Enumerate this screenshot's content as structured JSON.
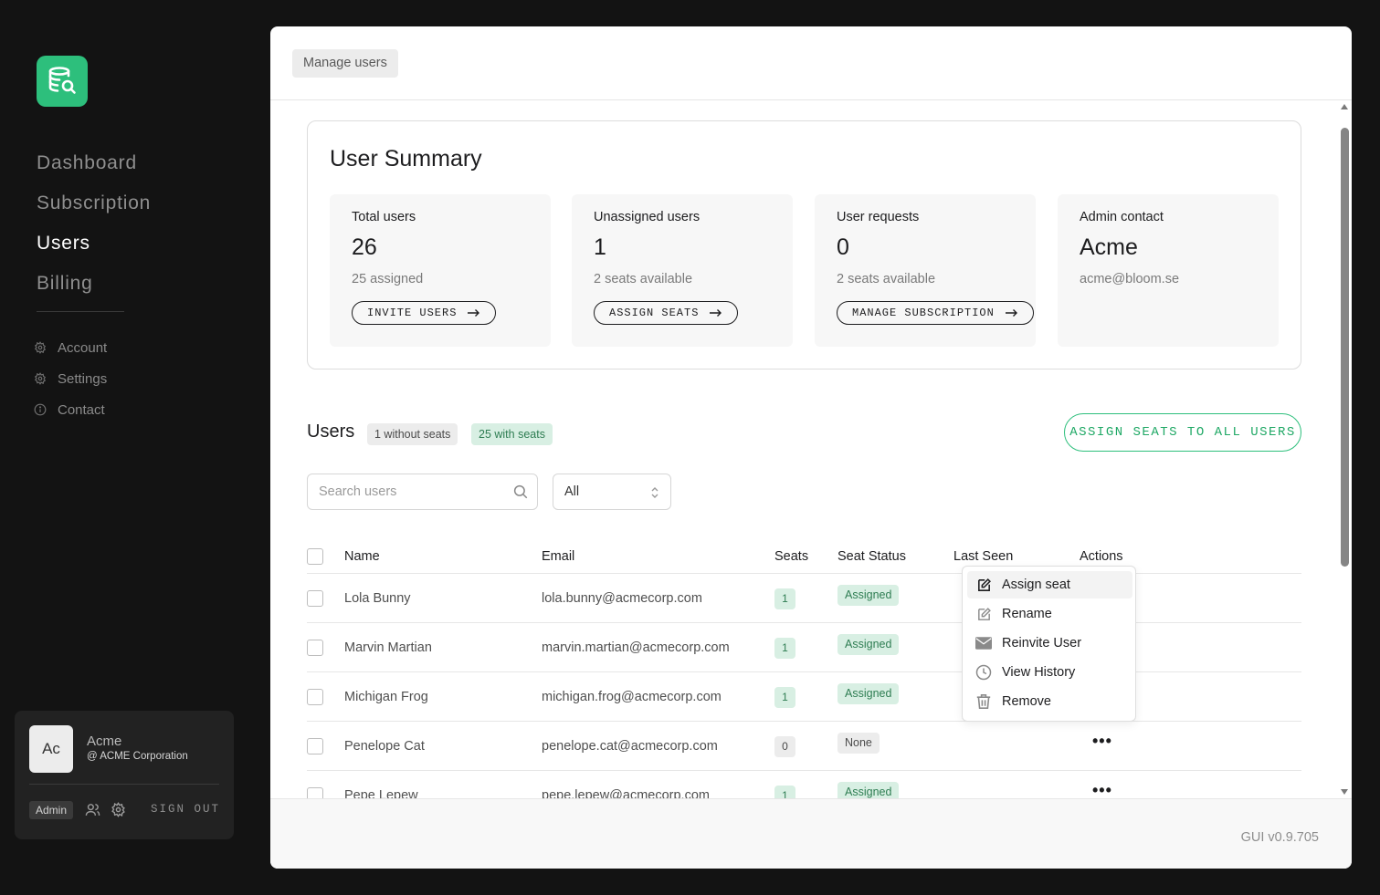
{
  "brand": {
    "accent": "#2dbf7c",
    "logo_icon": "database-search-icon"
  },
  "sidebar": {
    "nav": [
      {
        "label": "Dashboard",
        "active": false
      },
      {
        "label": "Subscription",
        "active": false
      },
      {
        "label": "Users",
        "active": true
      },
      {
        "label": "Billing",
        "active": false
      }
    ],
    "sub": [
      {
        "label": "Account",
        "icon": "gear-icon"
      },
      {
        "label": "Settings",
        "icon": "gear-icon"
      },
      {
        "label": "Contact",
        "icon": "info-icon"
      }
    ],
    "user_card": {
      "avatar": "Ac",
      "name": "Acme",
      "org": "@ ACME Corporation",
      "role": "Admin",
      "sign_out": "SIGN OUT"
    }
  },
  "breadcrumb": "Manage users",
  "summary": {
    "title": "User Summary",
    "cards": [
      {
        "label": "Total users",
        "value": "26",
        "sub": "25 assigned",
        "button": "INVITE USERS"
      },
      {
        "label": "Unassigned users",
        "value": "1",
        "sub": "2 seats available",
        "button": "ASSIGN SEATS"
      },
      {
        "label": "User requests",
        "value": "0",
        "sub": "2 seats available",
        "button": "MANAGE SUBSCRIPTION"
      },
      {
        "label": "Admin contact",
        "value": "Acme",
        "sub": "acme@bloom.se"
      }
    ]
  },
  "users": {
    "title": "Users",
    "without_seats": "1 without seats",
    "with_seats": "25 with seats",
    "assign_all": "ASSIGN SEATS TO ALL USERS",
    "search_placeholder": "Search users",
    "filter_value": "All",
    "columns": [
      "Name",
      "Email",
      "Seats",
      "Seat Status",
      "Last Seen",
      "Actions"
    ],
    "rows": [
      {
        "name": "Lola Bunny",
        "email": "lola.bunny@acmecorp.com",
        "seats": "1",
        "status": "Assigned"
      },
      {
        "name": "Marvin Martian",
        "email": "marvin.martian@acmecorp.com",
        "seats": "1",
        "status": "Assigned"
      },
      {
        "name": "Michigan Frog",
        "email": "michigan.frog@acmecorp.com",
        "seats": "1",
        "status": "Assigned"
      },
      {
        "name": "Penelope Cat",
        "email": "penelope.cat@acmecorp.com",
        "seats": "0",
        "status": "None"
      },
      {
        "name": "Pepe Lepew",
        "email": "pepe.lepew@acmecorp.com",
        "seats": "1",
        "status": "Assigned"
      }
    ],
    "more_glyph": "•••"
  },
  "action_menu": [
    {
      "label": "Assign seat",
      "icon": "edit-icon"
    },
    {
      "label": "Rename",
      "icon": "edit-icon"
    },
    {
      "label": "Reinvite User",
      "icon": "envelope-icon"
    },
    {
      "label": "View History",
      "icon": "clock-icon"
    },
    {
      "label": "Remove",
      "icon": "trash-icon"
    }
  ],
  "footer": {
    "version": "GUI v0.9.705"
  }
}
